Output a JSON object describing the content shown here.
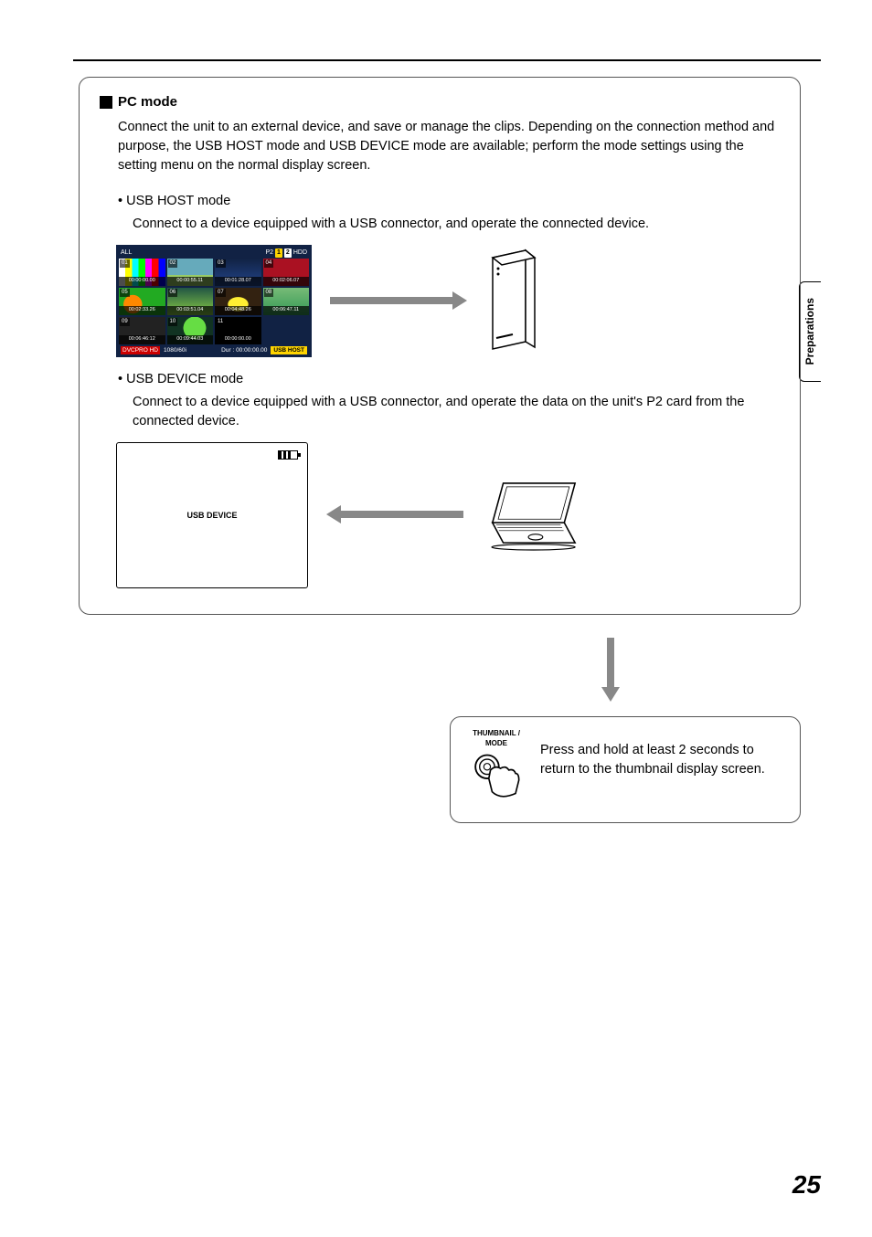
{
  "side_tab": "Preparations",
  "page_number": "25",
  "pc_mode": {
    "heading": "PC mode",
    "description": "Connect the unit to an external device, and save or manage the clips. Depending on the connection method and purpose, the USB HOST mode and USB DEVICE mode are available; perform the mode settings using the setting menu on the normal display screen.",
    "usb_host": {
      "title": "USB HOST mode",
      "desc": "Connect to a device equipped with a USB connector, and operate the connected device."
    },
    "usb_device": {
      "title": "USB DEVICE mode",
      "desc": "Connect to a device equipped with a USB connector, and operate the data on the unit's P2 card from the connected device.",
      "box_label": "USB DEVICE"
    }
  },
  "thumb": {
    "top_left": "ALL",
    "top_p2": "P2",
    "top_1": "1",
    "top_2": "2",
    "top_hdd": "HDD",
    "cells": [
      {
        "n": "01",
        "tc": "00:00:00.00"
      },
      {
        "n": "02",
        "tc": "00:00:55.11"
      },
      {
        "n": "03",
        "tc": "00:01:28.07"
      },
      {
        "n": "04",
        "tc": "00:02:06.07"
      },
      {
        "n": "05",
        "tc": "00:02:33.26"
      },
      {
        "n": "06",
        "tc": "00:03:51.04"
      },
      {
        "n": "07",
        "tc": "00:04:48.26"
      },
      {
        "n": "08",
        "tc": "00:06:47.11"
      },
      {
        "n": "09",
        "tc": "00:06:46:12"
      },
      {
        "n": "10",
        "tc": "00:09:44.03"
      },
      {
        "n": "11",
        "tc": "00:00:00.00"
      }
    ],
    "bottom_fmt": "DVCPRO HD",
    "bottom_res": "1080/60i",
    "bottom_dur": "Dur : 00:00:00.00",
    "bottom_mode": "USB HOST"
  },
  "bottom_instruction": {
    "button_label_1": "THUMBNAIL /",
    "button_label_2": "MODE",
    "text": "Press and hold at least 2 seconds to return to the thumbnail display screen."
  }
}
